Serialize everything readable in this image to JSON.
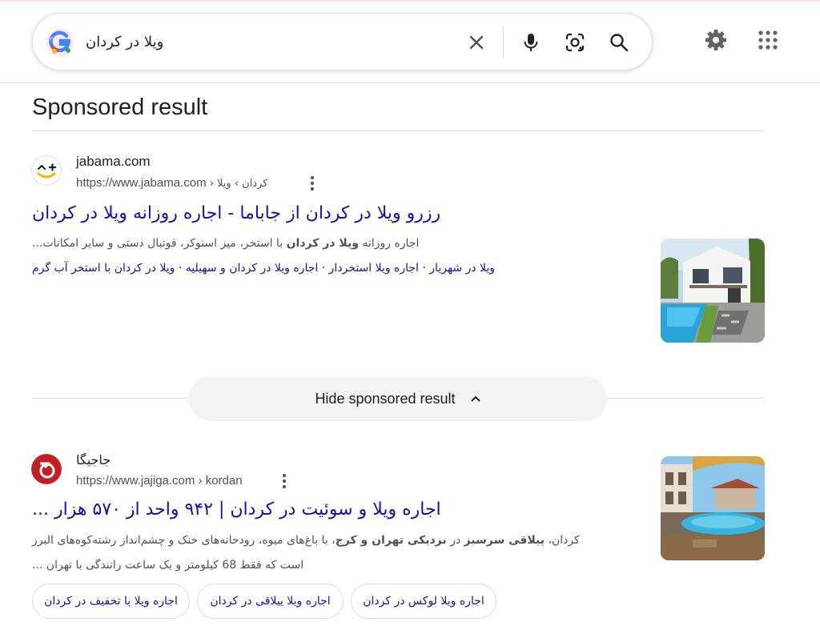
{
  "search": {
    "query": "ویلا در کردان",
    "icons": [
      "clear-icon",
      "mic-icon",
      "lens-icon",
      "search-icon"
    ]
  },
  "header": {
    "icons": [
      "settings-gear-icon",
      "apps-grid-icon"
    ]
  },
  "sponsored": {
    "heading": "Sponsored result",
    "site_name": "jabama.com",
    "url": "https://www.jabama.com",
    "breadcrumb": " › کردان › ویلا",
    "title": "رزرو ویلا در کردان از جاباما - اجاره روزانه ویلا در کردان",
    "snippet_parts": [
      {
        "text": "اجاره روزانه ",
        "bold": false
      },
      {
        "text": "ویلا در کردان",
        "bold": true
      },
      {
        "text": " با استخر، میز اسنوکر، فوتبال دستی و سایر امکانات...",
        "bold": false
      }
    ],
    "sitelinks": [
      "ویلا در شهریار",
      "اجاره ویلا استخردار",
      "اجاره ویلا در کردان و سهیلیه",
      "ویلا در کردان با استخر آب گرم"
    ],
    "sitelink_separator": " · "
  },
  "hide_button": {
    "label": "Hide sponsored result"
  },
  "organic": {
    "site_name": "جاجیگا",
    "url": "https://www.jajiga.com",
    "breadcrumb": " › kordan",
    "title": "اجاره ویلا و سوئیت در کردان | ۹۴۲ واحد از ۵۷۰ هزار ...",
    "snippet_line1_parts": [
      {
        "text": "کردان، ",
        "bold": false
      },
      {
        "text": "ییلاقی سرسبز",
        "bold": true
      },
      {
        "text": " در ",
        "bold": false
      },
      {
        "text": "نزدیکی تهران و کرج",
        "bold": true
      },
      {
        "text": "، با باغ‌های میوه، رودخانه‌های خنک و چشم‌انداز رشته‌کوه‌های البرز",
        "bold": false
      }
    ],
    "snippet_line2": "است که فقط 68 کیلومتر و یک ساعت رانندگی با تهران ...",
    "chips": [
      "اجاره ویلا لوکس در کردان",
      "اجاره ویلا ییلاقی در کردان",
      "اجاره ویلا با تخفیف در کردان"
    ]
  },
  "colors": {
    "link": "#1a0dab",
    "text": "#202124",
    "muted": "#4d5156",
    "border": "#dadce0",
    "button_bg": "#f1f3f4"
  }
}
